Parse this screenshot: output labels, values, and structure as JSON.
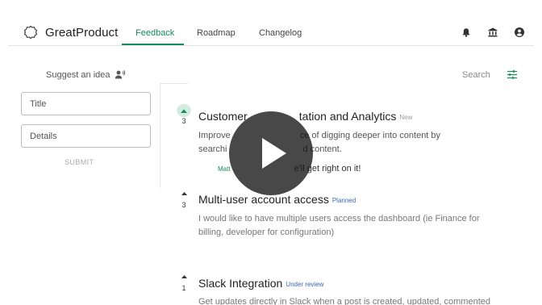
{
  "app": {
    "brand": "GreatProduct",
    "accent_color": "#1a8a5a"
  },
  "nav": {
    "tabs": [
      {
        "label": "Feedback",
        "active": true
      },
      {
        "label": "Roadmap",
        "active": false
      },
      {
        "label": "Changelog",
        "active": false
      }
    ],
    "icons": [
      "bell-icon",
      "bank-icon",
      "account-icon"
    ]
  },
  "suggest": {
    "heading": "Suggest an idea",
    "title_placeholder": "Title",
    "details_placeholder": "Details",
    "submit_label": "SUBMIT"
  },
  "search": {
    "placeholder": "Search"
  },
  "posts": [
    {
      "votes": "3",
      "voted": true,
      "title": "Customer",
      "title_tail": "tation and Analytics",
      "status": "New",
      "description_a": "Improve",
      "description_a_tail": "ce of digging deeper into content by",
      "description_b": "searchi",
      "description_b_tail": "d content.",
      "reply_tag": "Matt",
      "reply_text": "e'll get right on it!"
    },
    {
      "votes": "3",
      "voted": false,
      "title": "Multi-user account access",
      "status": "Planned",
      "description_a": "I would like to have multiple users access the dashboard (ie Finance for",
      "description_b": "billing, developer for configuration)"
    },
    {
      "votes": "1",
      "voted": false,
      "title": "Slack Integration",
      "status": "Under review",
      "description_a": "Get updates directly in Slack when a post is created, updated, commented"
    }
  ],
  "video": {
    "control": "play-icon"
  }
}
